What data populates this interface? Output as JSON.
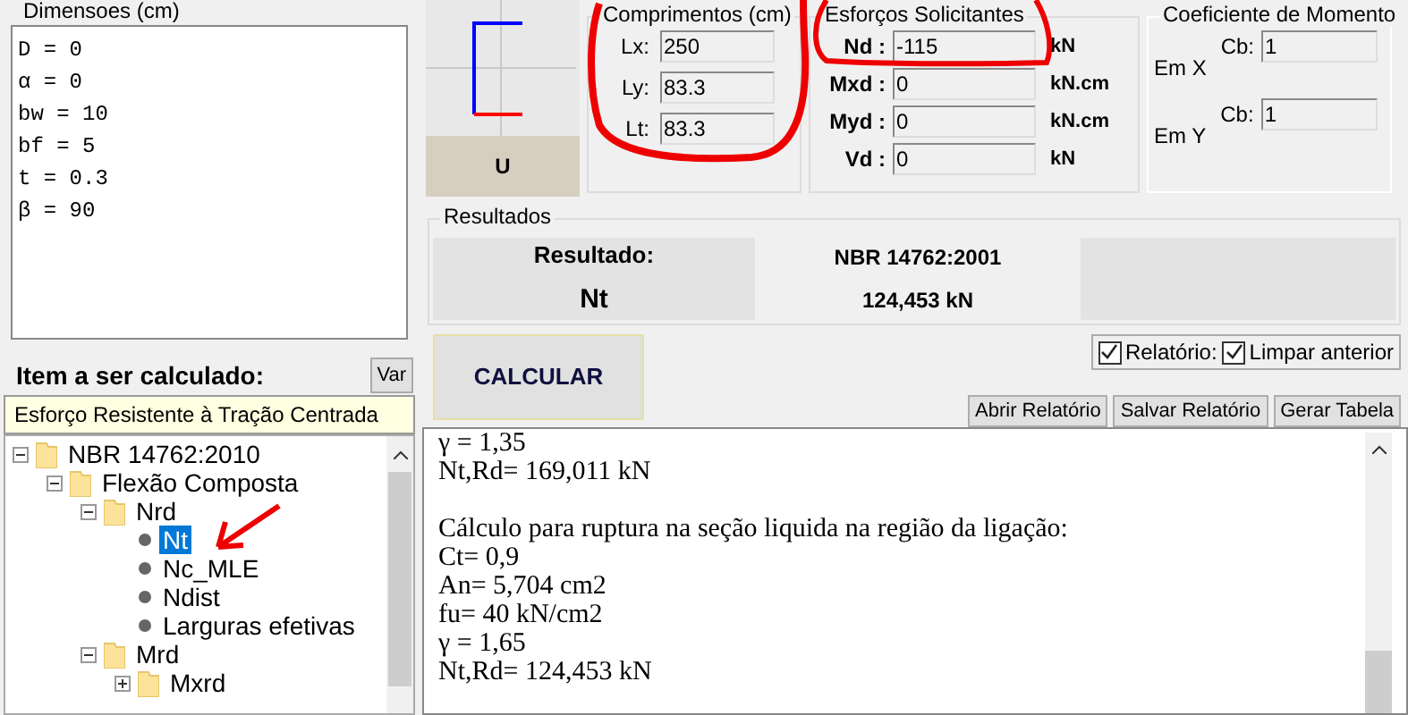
{
  "dimensions": {
    "title": "Dimensoes (cm)",
    "lines": [
      "D = 0",
      "α = 0",
      "bw = 10",
      "bf = 5",
      "t = 0.3",
      "β = 90"
    ]
  },
  "item_panel": {
    "title": "Item a ser calculado:",
    "var_button": "Var",
    "description": "Esforço Resistente à Tração Centrada"
  },
  "tree": [
    {
      "label": "NBR 14762:2010",
      "kind": "folder",
      "expanded": true,
      "selected": false,
      "children": [
        {
          "label": "Flexão Composta",
          "kind": "folder",
          "expanded": true,
          "selected": false,
          "children": [
            {
              "label": "Nrd",
              "kind": "folder",
              "expanded": true,
              "selected": false,
              "children": [
                {
                  "label": "Nt",
                  "kind": "leaf",
                  "selected": true
                },
                {
                  "label": "Nc_MLE",
                  "kind": "leaf",
                  "selected": false
                },
                {
                  "label": "Ndist",
                  "kind": "leaf",
                  "selected": false
                },
                {
                  "label": "Larguras efetivas",
                  "kind": "leaf",
                  "selected": false
                }
              ]
            },
            {
              "label": "Mrd",
              "kind": "folder",
              "expanded": true,
              "selected": false,
              "children": [
                {
                  "label": "Mxrd",
                  "kind": "folder",
                  "expanded": false,
                  "selected": false
                }
              ]
            }
          ]
        }
      ]
    }
  ],
  "section": {
    "label": "U"
  },
  "lengths": {
    "title": "Comprimentos (cm)",
    "fields": [
      {
        "label": "Lx:",
        "value": "250"
      },
      {
        "label": "Ly:",
        "value": "83.3"
      },
      {
        "label": "Lt:",
        "value": "83.3"
      }
    ]
  },
  "forces": {
    "title": "Esforços Solicitantes",
    "fields": [
      {
        "label": "Nd :",
        "value": "-115",
        "unit": "kN"
      },
      {
        "label": "Mxd :",
        "value": "0",
        "unit": "kN.cm"
      },
      {
        "label": "Myd :",
        "value": "0",
        "unit": "kN.cm"
      },
      {
        "label": "Vd :",
        "value": "0",
        "unit": "kN"
      }
    ]
  },
  "moment_coefficient": {
    "title": "Coeficiente de Momento",
    "rows": [
      {
        "axis": "Em X",
        "label": "Cb:",
        "value": "1"
      },
      {
        "axis": "Em Y",
        "label": "Cb:",
        "value": "1"
      }
    ]
  },
  "results": {
    "title": "Resultados",
    "heading": "Resultado:",
    "item": "Nt",
    "standard": "NBR 14762:2001",
    "value": "124,453 kN"
  },
  "calculate_button": "CALCULAR",
  "options": [
    {
      "label": "Relatório:",
      "checked": true
    },
    {
      "label": "Limpar anterior",
      "checked": true
    }
  ],
  "report_buttons": [
    "Abrir Relatório",
    "Salvar Relatório",
    "Gerar Tabela"
  ],
  "report_paragraphs": [
    [
      "γ = 1,35",
      "Nt,Rd= 169,011 kN"
    ],
    [
      "Cálculo para ruptura na seção liquida na região da ligação:",
      "Ct= 0,9",
      "An= 5,704 cm2",
      "fu= 40 kN/cm2",
      "γ = 1,65",
      "Nt,Rd= 124,453 kN"
    ]
  ]
}
